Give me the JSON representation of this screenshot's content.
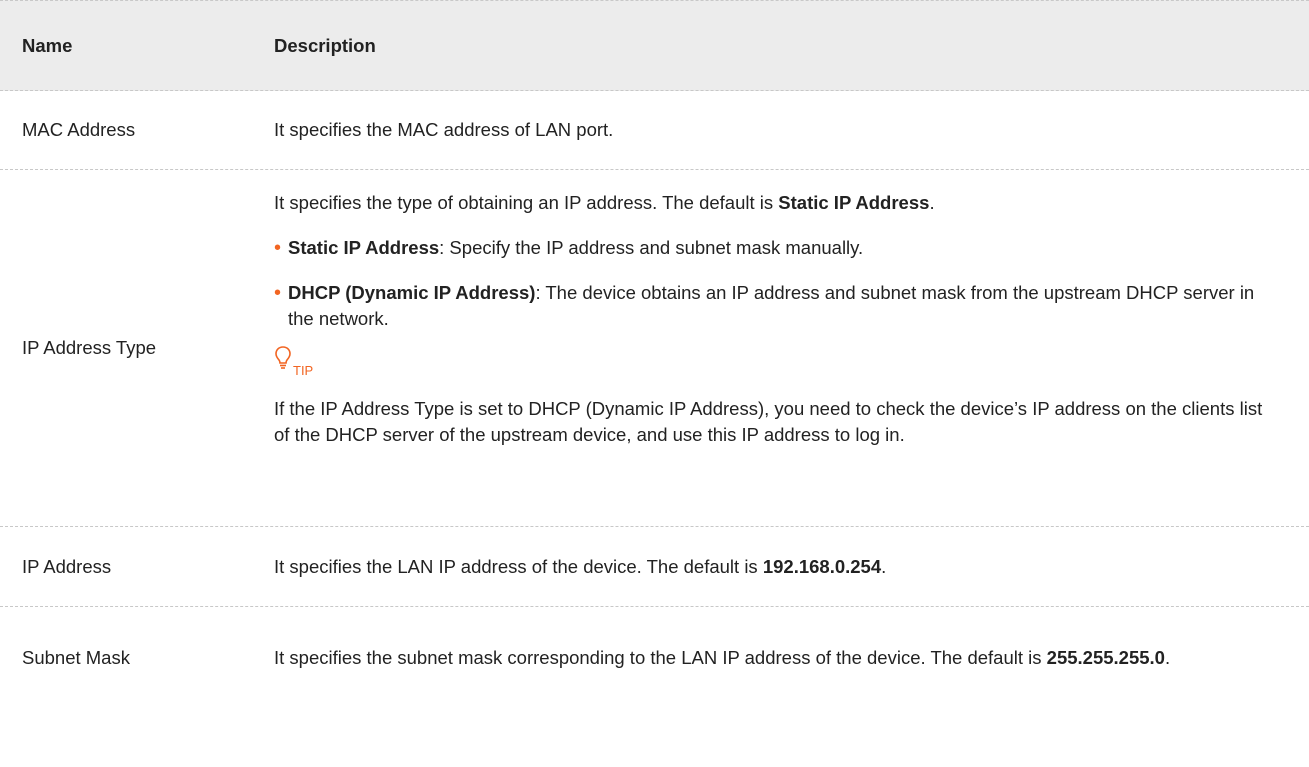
{
  "table": {
    "header": {
      "name": "Name",
      "description": "Description"
    },
    "rows": {
      "mac": {
        "name": "MAC Address",
        "desc": "It specifies the MAC address of LAN port."
      },
      "iptype": {
        "name": "IP Address Type",
        "intro_pre": "It specifies the type of obtaining an IP address. The default is ",
        "intro_bold": "Static IP Address",
        "intro_post": ".",
        "bullets": [
          {
            "bold": "Static IP Address",
            "text": ": Specify the IP address and subnet mask manually."
          },
          {
            "bold": "DHCP (Dynamic IP Address)",
            "text": ": The device obtains an IP address and subnet mask from the upstream DHCP server in the network."
          }
        ],
        "tip_label": "TIP",
        "tip_text": "If the IP Address Type is set to DHCP (Dynamic IP Address), you need to check the device’s IP address on the clients list of the DHCP server of the upstream device, and use this IP address to log in."
      },
      "ip": {
        "name": "IP Address",
        "desc_pre": "It specifies the LAN IP address of the device. The default is ",
        "desc_bold": "192.168.0.254",
        "desc_post": "."
      },
      "mask": {
        "name": "Subnet Mask",
        "desc_pre": "It specifies the subnet mask corresponding to the LAN IP address of the device. The default is ",
        "desc_bold": "255.255.255.0",
        "desc_post": "."
      }
    }
  },
  "colors": {
    "accent": "#f26522",
    "header_bg": "#ececec",
    "divider": "#c8c8c8"
  }
}
